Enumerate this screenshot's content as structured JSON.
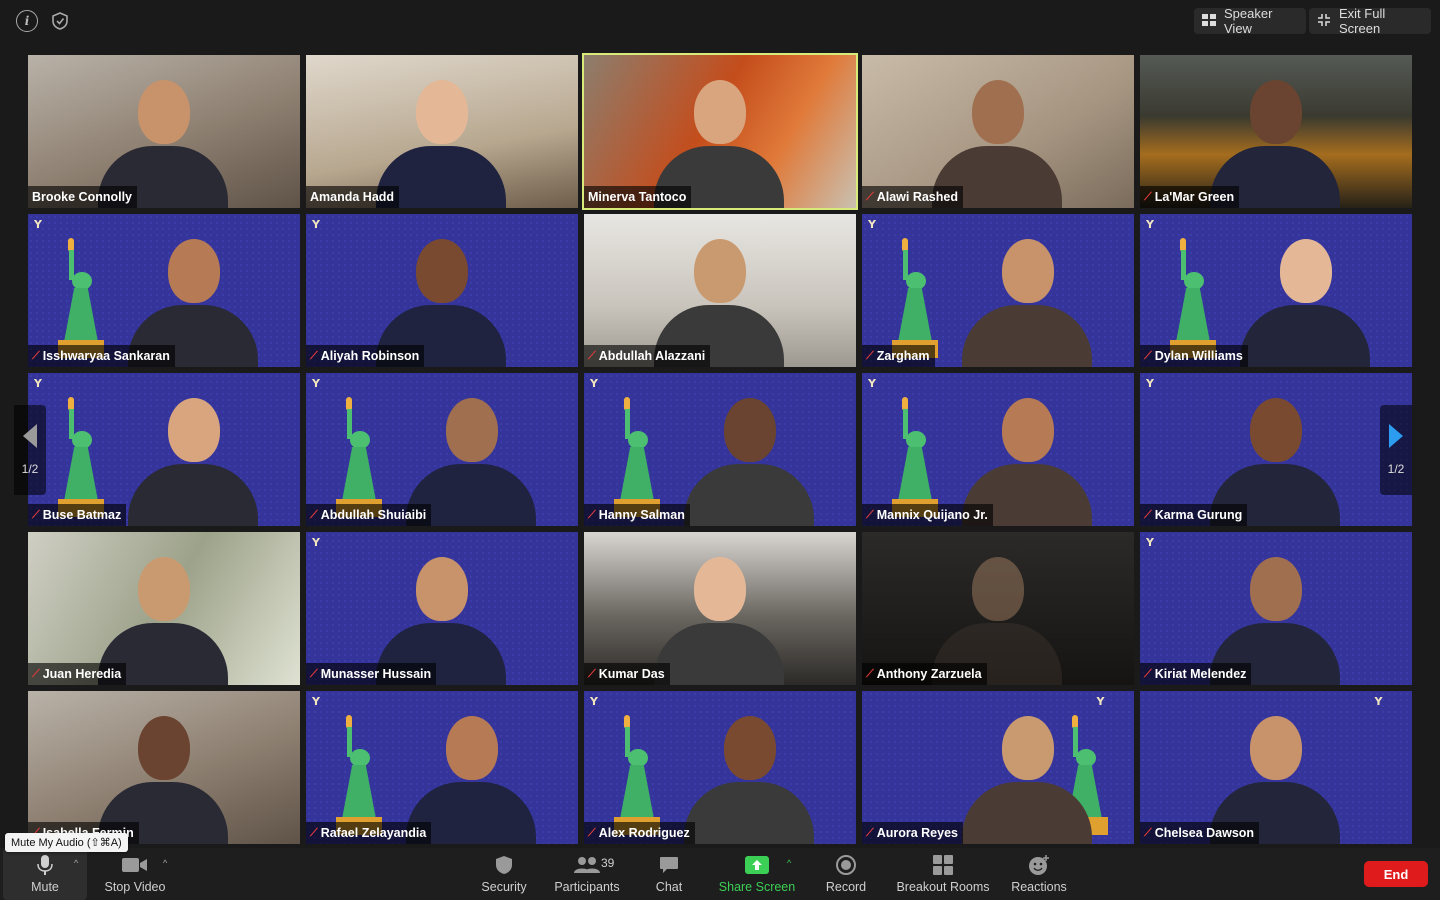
{
  "topbar": {
    "speaker_view": "Speaker View",
    "exit_full_screen": "Exit Full Screen"
  },
  "participants": [
    {
      "name": "Brooke Connolly",
      "muted": false,
      "bg": "room"
    },
    {
      "name": "Amanda Hadd",
      "muted": false,
      "bg": "room2"
    },
    {
      "name": "Minerva Tantoco",
      "muted": false,
      "bg": "warm",
      "active": true
    },
    {
      "name": "Alawi Rashed",
      "muted": true,
      "bg": "beige"
    },
    {
      "name": "La'Mar Green",
      "muted": true,
      "bg": "city"
    },
    {
      "name": "Isshwaryaa Sankaran",
      "muted": true,
      "bg": "purple",
      "liberty": true
    },
    {
      "name": "Aliyah Robinson",
      "muted": true,
      "bg": "purple",
      "liberty": false
    },
    {
      "name": "Abdullah Alazzani",
      "muted": true,
      "bg": "office"
    },
    {
      "name": "Zargham",
      "muted": true,
      "bg": "purple",
      "liberty": true
    },
    {
      "name": "Dylan Williams",
      "muted": true,
      "bg": "purple",
      "liberty": true
    },
    {
      "name": "Buse Batmaz",
      "muted": true,
      "bg": "purple",
      "liberty": true
    },
    {
      "name": "Abdullah Shuiaibi",
      "muted": true,
      "bg": "purple",
      "liberty": true
    },
    {
      "name": "Hanny Salman",
      "muted": true,
      "bg": "purple",
      "liberty": true
    },
    {
      "name": "Mannix Quijano Jr.",
      "muted": true,
      "bg": "purple",
      "liberty": true
    },
    {
      "name": "Karma Gurung",
      "muted": true,
      "bg": "purple",
      "liberty": false
    },
    {
      "name": "Juan Heredia",
      "muted": true,
      "bg": "money"
    },
    {
      "name": "Munasser Hussain",
      "muted": true,
      "bg": "purple",
      "liberty": false
    },
    {
      "name": "Kumar Das",
      "muted": true,
      "bg": "closet"
    },
    {
      "name": "Anthony Zarzuela",
      "muted": true,
      "bg": "dark"
    },
    {
      "name": "Kiriat Melendez",
      "muted": true,
      "bg": "purple",
      "liberty": false
    },
    {
      "name": "Isabella Fermin",
      "muted": true,
      "bg": "room"
    },
    {
      "name": "Rafael Zelayandia",
      "muted": true,
      "bg": "purple",
      "liberty": true
    },
    {
      "name": "Alex Rodriguez",
      "muted": true,
      "bg": "purple",
      "liberty": true
    },
    {
      "name": "Aurora Reyes",
      "muted": true,
      "bg": "purple",
      "liberty": true
    },
    {
      "name": "Chelsea Dawson",
      "muted": true,
      "bg": "purple",
      "liberty": false
    }
  ],
  "pager": {
    "left": "1/2",
    "right": "1/2"
  },
  "tooltip": "Mute My Audio (⇧⌘A)",
  "toolbar": {
    "mute": "Mute",
    "stop_video": "Stop Video",
    "security": "Security",
    "participants": "Participants",
    "participant_count": "39",
    "chat": "Chat",
    "share_screen": "Share Screen",
    "record": "Record",
    "breakout_rooms": "Breakout Rooms",
    "reactions": "Reactions",
    "end": "End"
  },
  "colors": {
    "accent_active": "#d8ea7a",
    "share_green": "#3ccf55",
    "end_red": "#e01b1b",
    "muted_red": "#e23b3b",
    "virtual_bg": "#34349a"
  }
}
